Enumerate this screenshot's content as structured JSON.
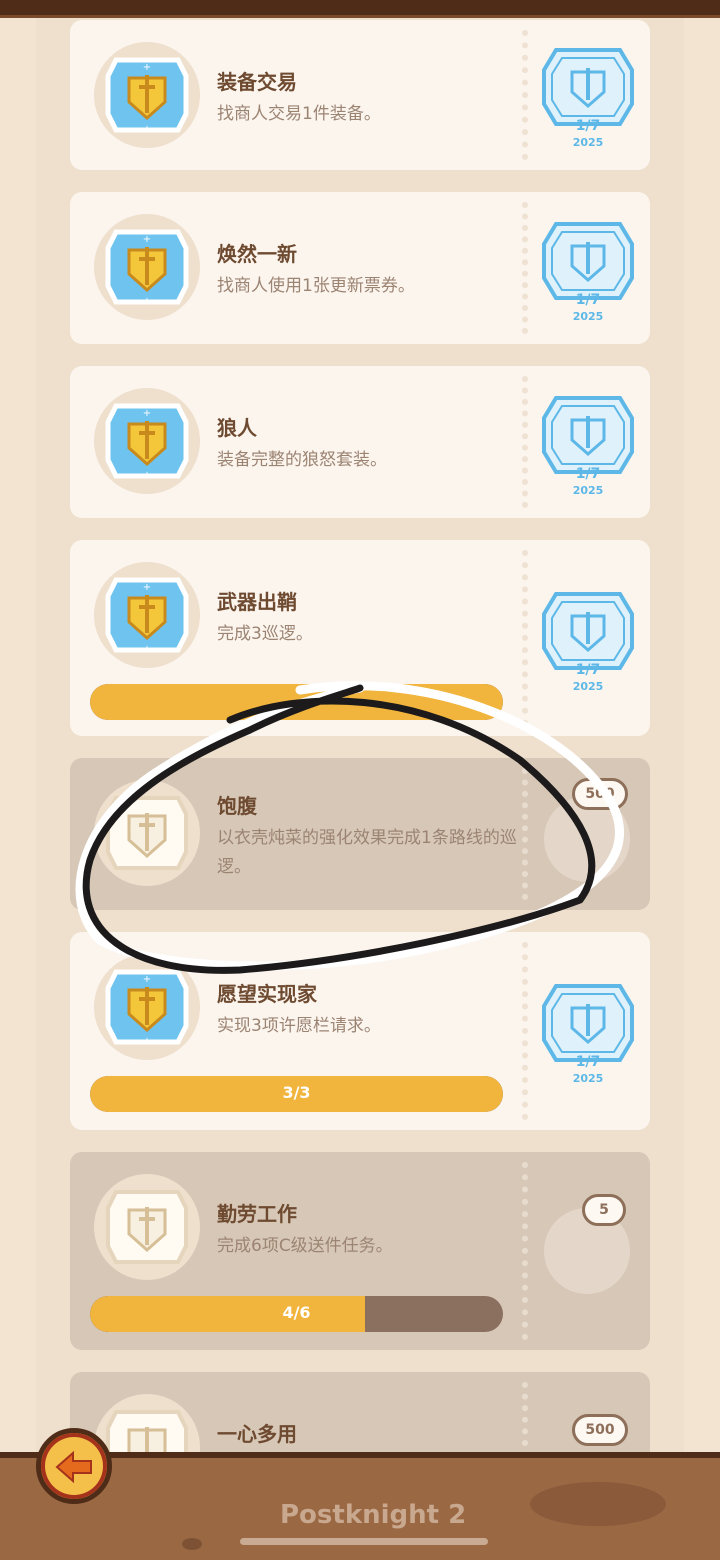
{
  "app": {
    "logo_text": "Postknight 2"
  },
  "achievements": [
    {
      "title": "装备交易",
      "description": "找商人交易1件装备。",
      "stamp": {
        "top": "1/7",
        "year": "2025"
      }
    },
    {
      "title": "焕然一新",
      "description": "找商人使用1张更新票券。",
      "stamp": {
        "top": "1/7",
        "year": "2025"
      }
    },
    {
      "title": "狼人",
      "description": "装备完整的狼怒套装。",
      "stamp": {
        "top": "1/7",
        "year": "2025"
      }
    },
    {
      "title": "武器出鞘",
      "description": "完成3巡逻。",
      "stamp": {
        "top": "1/7",
        "year": "2025"
      },
      "progress_fraction": 1.0
    },
    {
      "title": "饱腹",
      "description": "以衣壳炖菜的强化效果完成1条路线的巡逻。",
      "reward": "500"
    },
    {
      "title": "愿望实现家",
      "description": "实现3项许愿栏请求。",
      "stamp": {
        "top": "1/7",
        "year": "2025"
      },
      "progress_text": "3/3",
      "progress_fraction": 1.0
    },
    {
      "title": "勤劳工作",
      "description": "完成6项C级送件任务。",
      "reward": "5",
      "progress_text": "4/6",
      "progress_fraction": 0.667
    },
    {
      "title": "一心多用",
      "reward": "500"
    }
  ],
  "colors": {
    "accent": "#f1b43d",
    "brown": "#4e2c18",
    "card": "#fbf5ee",
    "locked_card": "#d7c7b7",
    "stamp_blue": "#5db8e8"
  },
  "icons": {
    "back_button": "arrow-left-icon",
    "badge": "shield-sword-icon",
    "reward": "chest-icon"
  }
}
